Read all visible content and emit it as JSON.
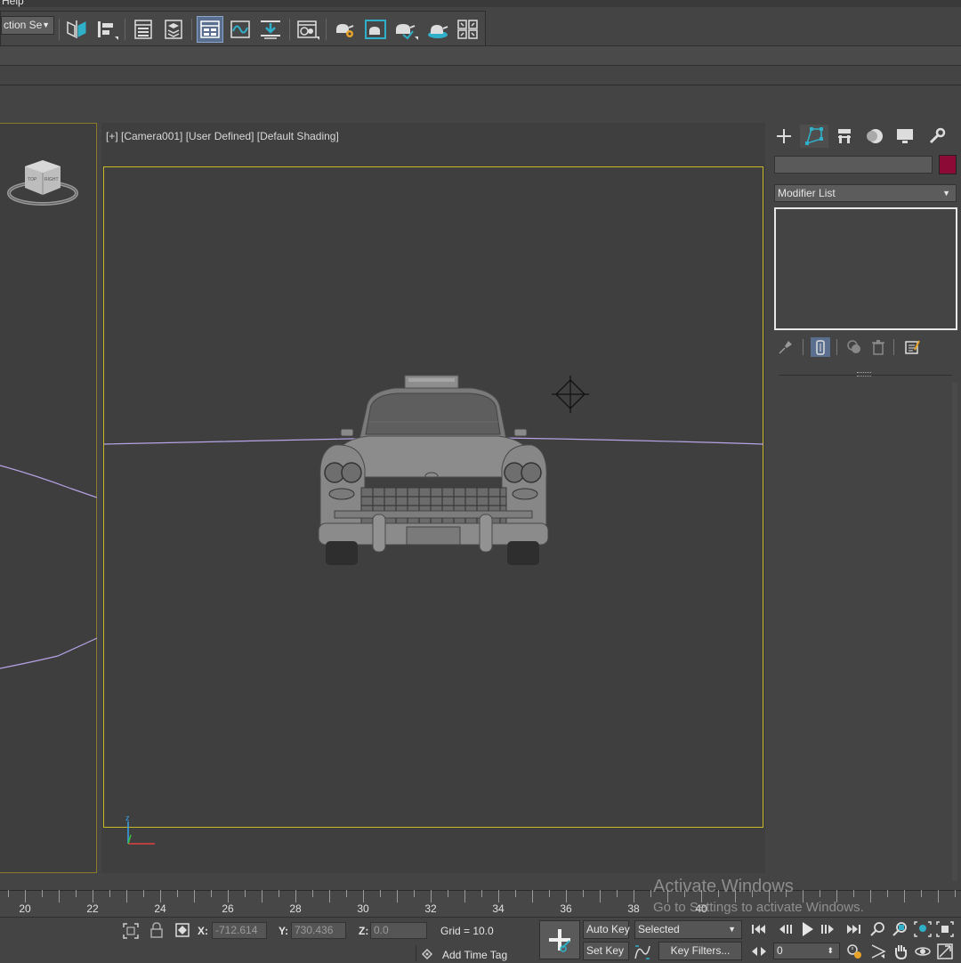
{
  "menu": {
    "partial_label": "Help"
  },
  "toolbar": {
    "selection_set": "ction Se",
    "icons": [
      "mirror-icon",
      "align-icon",
      "scene-explorer-icon",
      "layer-explorer-icon",
      "toggle-ribbon-icon",
      "curve-editor-icon",
      "schematic-view-icon",
      "material-editor-icon",
      "render-setup-icon",
      "rendered-frame-window-icon",
      "render-production-icon",
      "render-iterative-icon",
      "render-cloud-icon"
    ]
  },
  "viewport": {
    "label": "[+] [Camera001] [User Defined] [Default Shading]",
    "viewcube_labels": {
      "front": "TOP",
      "right": "RIGHT"
    },
    "axis_z": "z",
    "horizon_color": "#b6a3e6",
    "safe_frame_color": "#c8b82a"
  },
  "command_panel": {
    "tabs": [
      "create-tab",
      "modify-tab",
      "hierarchy-tab",
      "motion-tab",
      "display-tab",
      "utilities-tab"
    ],
    "object_name": "",
    "object_color": "#8b0a36",
    "modifier_list": "Modifier List",
    "stack_tools": [
      "pin-stack-icon",
      "show-end-result-icon",
      "make-unique-icon",
      "remove-modifier-icon",
      "configure-modifier-sets-icon"
    ]
  },
  "timeline": {
    "ticks": [
      "20",
      "22",
      "24",
      "26",
      "28",
      "30",
      "32",
      "34",
      "36",
      "38",
      "40"
    ]
  },
  "status": {
    "x_label": "X:",
    "x_value": "-712.614",
    "y_label": "Y:",
    "y_value": "730.436",
    "z_label": "Z:",
    "z_value": "0.0",
    "grid": "Grid = 10.0",
    "add_time_tag": "Add Time Tag",
    "auto_key": "Auto Key",
    "set_key": "Set Key",
    "key_mode": "Selected",
    "key_filters": "Key Filters...",
    "current_frame": "0"
  },
  "watermark": {
    "title": "Activate Windows",
    "subtitle": "Go to Settings to activate Windows."
  }
}
